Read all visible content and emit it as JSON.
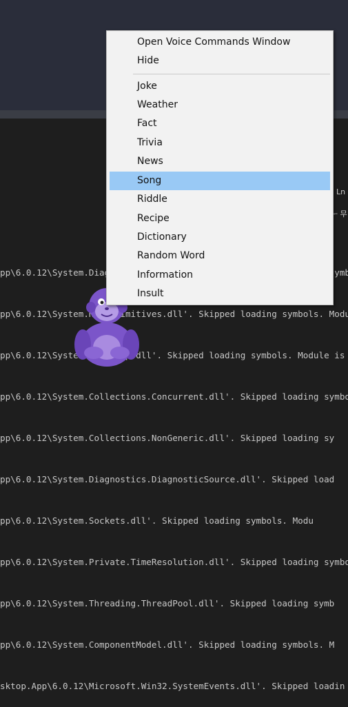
{
  "side_labels": {
    "ln": "Ln",
    "glyph": "ᅮ 무"
  },
  "output_lines": [
    "pp\\6.0.12\\System.Diagnostics.TraceSource.dll'. Skipped loading symbo",
    "pp\\6.0.12\\System.Net.Primitives.dll'. Skipped loading symbols. Modu",
    "pp\\6.0.12\\System.Net.Http.dll'. Skipped loading symbols. Module is op",
    "pp\\6.0.12\\System.Collections.Concurrent.dll'. Skipped loading symbols. Sk",
    "pp\\6.0.12\\System.Collections.NonGeneric.dll'. Skipped loading sy",
    "pp\\6.0.12\\System.Diagnostics.DiagnosticSource.dll'. Skipped load",
    "pp\\6.0.12\\System.Sockets.dll'. Skipped loading symbols. Modu",
    "pp\\6.0.12\\System.Private.TimeResolution.dll'. Skipped loading symbol",
    "pp\\6.0.12\\System.Threading.ThreadPool.dll'. Skipped loading symb",
    "pp\\6.0.12\\System.ComponentModel.dll'. Skipped loading symbols. M",
    "sktop.App\\6.0.12\\Microsoft.Win32.SystemEvents.dll'. Skipped loadin"
  ],
  "menu": {
    "items": [
      {
        "label": "Open Voice Commands Window"
      },
      {
        "label": "Hide"
      },
      {
        "label": "Joke"
      },
      {
        "label": "Weather"
      },
      {
        "label": "Fact"
      },
      {
        "label": "Trivia"
      },
      {
        "label": "News"
      },
      {
        "label": "Song"
      },
      {
        "label": "Riddle"
      },
      {
        "label": "Recipe"
      },
      {
        "label": "Dictionary"
      },
      {
        "label": "Random Word"
      },
      {
        "label": "Information"
      },
      {
        "label": "Insult"
      }
    ],
    "highlighted": "Song"
  },
  "colors": {
    "menu_bg": "#f2f2f2",
    "highlight": "#99c9f5",
    "character": "#7b55c9"
  }
}
